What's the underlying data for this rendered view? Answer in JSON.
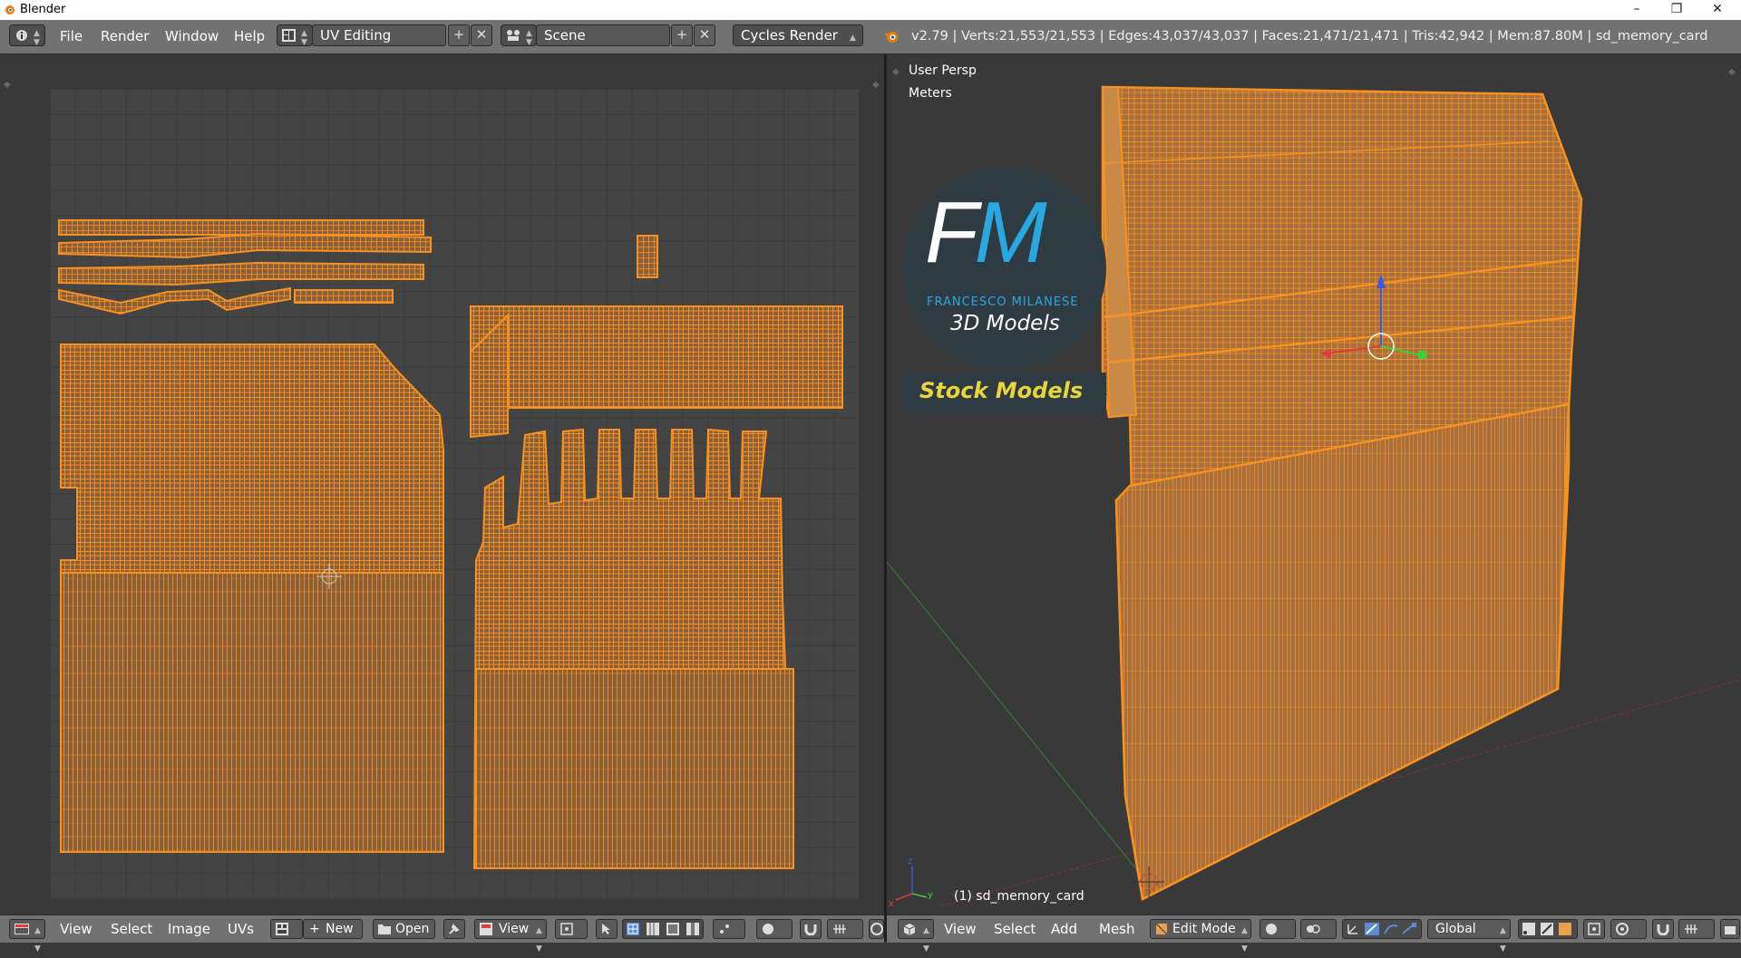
{
  "window": {
    "title": "Blender"
  },
  "header": {
    "menus": [
      "File",
      "Render",
      "Window",
      "Help"
    ],
    "layout_name": "UV Editing",
    "scene_name": "Scene",
    "render_engine": "Cycles Render",
    "stats": "v2.79 | Verts:21,553/21,553 | Edges:43,037/43,037 | Faces:21,471/21,471 | Tris:42,942 | Mem:87.80M | sd_memory_card"
  },
  "viewport": {
    "view_name": "User Persp",
    "units": "Meters",
    "object_label": "(1) sd_memory_card",
    "watermark_letters": "FM",
    "watermark_name": "FRANCESCO MILANESE",
    "watermark_sub": "3D Models",
    "watermark_banner": "Stock Models"
  },
  "uv_footer": {
    "menus": [
      "View",
      "Select",
      "Image",
      "UVs"
    ],
    "new_label": "New",
    "open_label": "Open",
    "view_label": "View"
  },
  "vp_footer": {
    "menus": [
      "View",
      "Select",
      "Add",
      "Mesh"
    ],
    "mode": "Edit Mode",
    "orientation": "Global"
  },
  "colors": {
    "mesh_orange": "#f7911f",
    "mesh_fill": "#b07a45",
    "header_bg": "#727272",
    "axis_x": "#e03a3a",
    "axis_y": "#3ccf3c",
    "axis_z": "#3a5ae0"
  }
}
